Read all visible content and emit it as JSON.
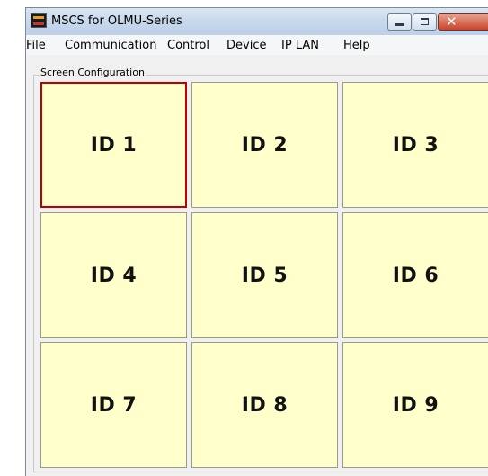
{
  "window": {
    "title": "MSCS for OLMU-Series",
    "icon": "app-logo-icon",
    "buttons": {
      "minimize": "minimize-icon",
      "maximize": "maximize-icon",
      "close_glyph": "✕"
    }
  },
  "menu": {
    "items": [
      {
        "label": "File"
      },
      {
        "label": "Communication"
      },
      {
        "label": "Control"
      },
      {
        "label": "Device"
      },
      {
        "label": "IP LAN"
      },
      {
        "label": "Help"
      }
    ]
  },
  "screen_configuration": {
    "label": "Screen Configuration",
    "selected_cell": "ID 1",
    "cells": [
      {
        "label": "ID 1"
      },
      {
        "label": "ID 2"
      },
      {
        "label": "ID 3"
      },
      {
        "label": "ID 4"
      },
      {
        "label": "ID 5"
      },
      {
        "label": "ID 6"
      },
      {
        "label": "ID 7"
      },
      {
        "label": "ID 8"
      },
      {
        "label": "ID 9"
      }
    ]
  },
  "colors": {
    "cell_background": "#ffffcc",
    "selected_border": "#c00000"
  }
}
